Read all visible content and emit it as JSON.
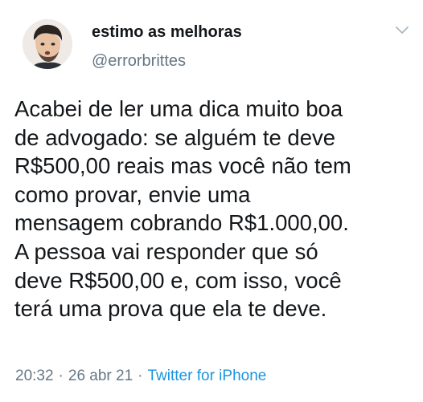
{
  "author": {
    "display_name": "estimo as melhoras",
    "handle": "@errorbrittes"
  },
  "tweet": {
    "text": "Acabei de ler uma dica muito boa\nde advogado: se alguém te deve\nR$500,00 reais mas você não tem\ncomo provar, envie uma\nmensagem cobrando R$1.000,00.\nA pessoa vai responder que só\ndeve R$500,00 e, com isso, você\nterá uma prova que ela te deve."
  },
  "meta": {
    "time": "20:32",
    "separator": "·",
    "date": "26 abr 21",
    "source": "Twitter for iPhone"
  },
  "colors": {
    "text": "#14171a",
    "secondary": "#657786",
    "link": "#1b95e0"
  },
  "icons": {
    "menu": "chevron-down-icon",
    "avatar": "avatar"
  }
}
